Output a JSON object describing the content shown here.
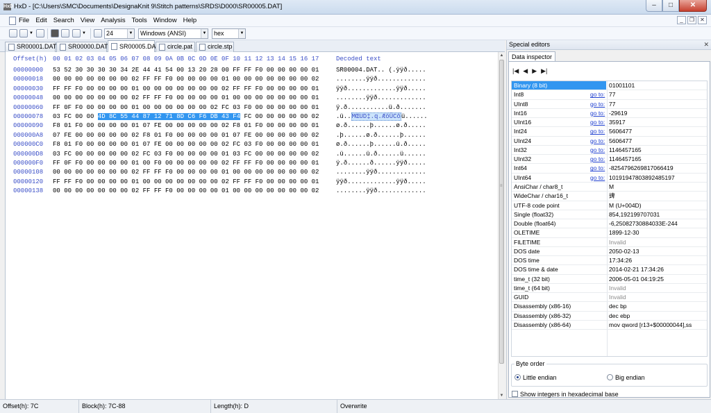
{
  "window": {
    "app_icon": "HxD",
    "title": "HxD - [C:\\Users\\SMC\\Documents\\DesignaKnit 9\\Stitch patterns\\SRDS\\D000\\SR00005.DAT]",
    "minimize_icon": "minimize-icon",
    "maximize_icon": "maximize-icon",
    "close_icon": "close-icon"
  },
  "menu": {
    "items": [
      "File",
      "Edit",
      "Search",
      "View",
      "Analysis",
      "Tools",
      "Window",
      "Help"
    ]
  },
  "toolbar": {
    "bytes_per_row": "24",
    "charset": "Windows (ANSI)",
    "offset_base": "hex"
  },
  "tabs": [
    {
      "label": "SR00001.DAT",
      "active": false
    },
    {
      "label": "SR00000.DAT",
      "active": false
    },
    {
      "label": "SR00005.DAT",
      "active": true
    },
    {
      "label": "circle.pat",
      "active": false
    },
    {
      "label": "circle.stp",
      "active": false
    }
  ],
  "hex": {
    "offset_header": "Offset(h)",
    "columns": [
      "00",
      "01",
      "02",
      "03",
      "04",
      "05",
      "06",
      "07",
      "08",
      "09",
      "0A",
      "0B",
      "0C",
      "0D",
      "0E",
      "0F",
      "10",
      "11",
      "12",
      "13",
      "14",
      "15",
      "16",
      "17"
    ],
    "decoded_header": "Decoded text",
    "rows": [
      {
        "offset": "00000000",
        "bytes": "53 52 30 30 30 30 34 2E 44 41 54 00 13 20 28 00 FF FF F0 00 00 00 00 01",
        "decoded": "SR00004.DAT.. (.ÿÿð....."
      },
      {
        "offset": "00000018",
        "bytes": "00 00 00 00 00 00 00 02 FF FF F0 00 00 00 00 01 00 00 00 00 00 00 00 02",
        "decoded": "........ÿÿð............."
      },
      {
        "offset": "00000030",
        "bytes": "FF FF F0 00 00 00 00 01 00 00 00 00 00 00 00 02 FF FF F0 00 00 00 00 01",
        "decoded": "ÿÿð.............ÿÿð....."
      },
      {
        "offset": "00000048",
        "bytes": "00 00 00 00 00 00 00 02 FF FF F0 00 00 00 00 01 00 00 00 00 00 00 00 01",
        "decoded": "........ÿÿð............."
      },
      {
        "offset": "00000060",
        "bytes": "FF 0F F0 00 00 00 00 01 00 00 00 00 00 00 02 FC 03 F0 00 00 00 00 00 01",
        "decoded": "ÿ.ð...........ü.ð......."
      },
      {
        "offset": "00000078",
        "bytes_pre": "03 FC 00 00 ",
        "bytes_sel": "4D 8C 55 44 87 12 71 8D C6 F6 DB 43 F4",
        "bytes_post": " FC 00 00 00 00 00 02",
        "decoded_pre": ".ü..",
        "decoded_sel": "MŒUD‡.q.ÆöÛCô",
        "decoded_post": "ü......"
      },
      {
        "offset": "00000090",
        "bytes": "F8 01 F0 00 00 00 00 01 07 FE 00 00 00 00 00 02 F8 01 F0 00 00 00 00 01",
        "decoded": "ø.ð......þ......ø.ð....."
      },
      {
        "offset": "000000A8",
        "bytes": "07 FE 00 00 00 00 00 02 F8 01 F0 00 00 00 00 01 07 FE 00 00 00 00 00 02",
        "decoded": ".þ......ø.ð......þ......"
      },
      {
        "offset": "000000C0",
        "bytes": "F8 01 F0 00 00 00 00 01 07 FE 00 00 00 00 00 02 FC 03 F0 00 00 00 00 01",
        "decoded": "ø.ð......þ......ü.ð....."
      },
      {
        "offset": "000000D8",
        "bytes": "03 FC 00 00 00 00 00 02 FC 03 F0 00 00 00 00 01 03 FC 00 00 00 00 00 02",
        "decoded": ".ü......ü.ð......ü......"
      },
      {
        "offset": "000000F0",
        "bytes": "FF 0F F0 00 00 00 00 01 00 F0 00 00 00 00 00 02 FF FF F0 00 00 00 00 01",
        "decoded": "ÿ.ð......ð......ÿÿð....."
      },
      {
        "offset": "00000108",
        "bytes": "00 00 00 00 00 00 00 02 FF FF F0 00 00 00 00 01 00 00 00 00 00 00 00 02",
        "decoded": "........ÿÿð............."
      },
      {
        "offset": "00000120",
        "bytes": "FF FF F0 00 00 00 00 01 00 00 00 00 00 00 00 02 FF FF F0 00 00 00 00 01",
        "decoded": "ÿÿð.............ÿÿð....."
      },
      {
        "offset": "00000138",
        "bytes": "00 00 00 00 00 00 00 02 FF FF F0 00 00 00 00 01 00 00 00 00 00 00 00 02",
        "decoded": "........ÿÿð............."
      }
    ]
  },
  "special_editors": {
    "title": "Special editors",
    "close_icon": "close-icon",
    "tab": "Data inspector",
    "nav": {
      "first": "|◀",
      "prev": "◀",
      "next": "▶",
      "last": "▶|"
    },
    "goto_label": "go to:",
    "rows": [
      {
        "key": "Binary (8 bit)",
        "value": "01001101",
        "goto": false,
        "selected": true
      },
      {
        "key": "Int8",
        "value": "77",
        "goto": true
      },
      {
        "key": "UInt8",
        "value": "77",
        "goto": true
      },
      {
        "key": "Int16",
        "value": "-29619",
        "goto": true
      },
      {
        "key": "UInt16",
        "value": "35917",
        "goto": true
      },
      {
        "key": "Int24",
        "value": "5606477",
        "goto": true
      },
      {
        "key": "UInt24",
        "value": "5606477",
        "goto": true
      },
      {
        "key": "Int32",
        "value": "1146457165",
        "goto": true
      },
      {
        "key": "UInt32",
        "value": "1146457165",
        "goto": true
      },
      {
        "key": "Int64",
        "value": "-8254796269817066419",
        "goto": true
      },
      {
        "key": "UInt64",
        "value": "10191947803892485197",
        "goto": true
      },
      {
        "key": "AnsiChar / char8_t",
        "value": "M",
        "goto": false
      },
      {
        "key": "WideChar / char16_t",
        "value": "豍",
        "goto": false
      },
      {
        "key": "UTF-8 code point",
        "value": "M (U+004D)",
        "goto": false
      },
      {
        "key": "Single (float32)",
        "value": "854,192199707031",
        "goto": false
      },
      {
        "key": "Double (float64)",
        "value": "-6,25082730884033E-244",
        "goto": false
      },
      {
        "key": "OLETIME",
        "value": "1899-12-30",
        "goto": false
      },
      {
        "key": "FILETIME",
        "value": "Invalid",
        "goto": false,
        "invalid": true
      },
      {
        "key": "DOS date",
        "value": "2050-02-13",
        "goto": false
      },
      {
        "key": "DOS time",
        "value": "17:34:26",
        "goto": false
      },
      {
        "key": "DOS time & date",
        "value": "2014-02-21 17:34:26",
        "goto": false
      },
      {
        "key": "time_t (32 bit)",
        "value": "2006-05-01 04:19:25",
        "goto": false
      },
      {
        "key": "time_t (64 bit)",
        "value": "Invalid",
        "goto": false,
        "invalid": true
      },
      {
        "key": "GUID",
        "value": "Invalid",
        "goto": false,
        "invalid": true
      },
      {
        "key": "Disassembly (x86-16)",
        "value": "dec bp",
        "goto": false
      },
      {
        "key": "Disassembly (x86-32)",
        "value": "dec ebp",
        "goto": false
      },
      {
        "key": "Disassembly (x86-64)",
        "value": "mov qword [r13+$00000044],ss",
        "goto": false
      }
    ],
    "byte_order": {
      "legend": "Byte order",
      "little": "Little endian",
      "big": "Big endian",
      "selected": "little"
    },
    "hex_checkbox": "Show integers in hexadecimal base"
  },
  "status": {
    "offset": "Offset(h): 7C",
    "block": "Block(h): 7C-88",
    "length": "Length(h): D",
    "mode": "Overwrite"
  },
  "colors": {
    "selection": "#3296f0",
    "offset_blue": "#3c50c8",
    "link_blue": "#2040d0"
  }
}
